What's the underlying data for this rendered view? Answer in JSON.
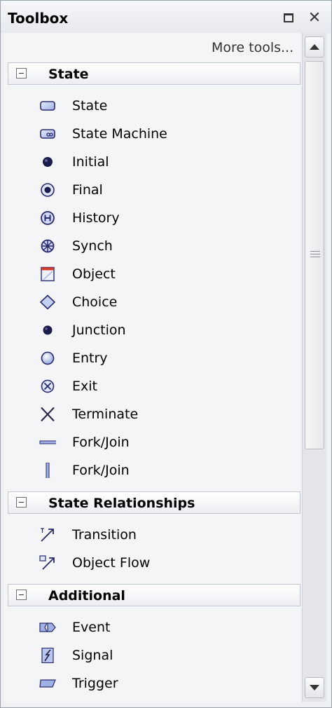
{
  "window": {
    "title": "Toolbox",
    "maximize_icon": "restore-window-icon",
    "close_glyph": "✕"
  },
  "more_tools": "More tools...",
  "groups": [
    {
      "title": "State",
      "items": [
        {
          "label": "State",
          "icon": "state-icon"
        },
        {
          "label": "State Machine",
          "icon": "state-machine-icon"
        },
        {
          "label": "Initial",
          "icon": "initial-icon"
        },
        {
          "label": "Final",
          "icon": "final-icon"
        },
        {
          "label": "History",
          "icon": "history-icon"
        },
        {
          "label": "Synch",
          "icon": "synch-icon"
        },
        {
          "label": "Object",
          "icon": "object-icon"
        },
        {
          "label": "Choice",
          "icon": "choice-icon"
        },
        {
          "label": "Junction",
          "icon": "junction-icon"
        },
        {
          "label": "Entry",
          "icon": "entry-icon"
        },
        {
          "label": "Exit",
          "icon": "exit-icon"
        },
        {
          "label": "Terminate",
          "icon": "terminate-icon"
        },
        {
          "label": "Fork/Join",
          "icon": "fork-join-horizontal-icon"
        },
        {
          "label": "Fork/Join",
          "icon": "fork-join-vertical-icon"
        }
      ]
    },
    {
      "title": "State Relationships",
      "items": [
        {
          "label": "Transition",
          "icon": "transition-icon"
        },
        {
          "label": "Object Flow",
          "icon": "object-flow-icon"
        }
      ]
    },
    {
      "title": "Additional",
      "items": [
        {
          "label": "Event",
          "icon": "event-icon"
        },
        {
          "label": "Signal",
          "icon": "signal-icon"
        },
        {
          "label": "Trigger",
          "icon": "trigger-icon"
        }
      ]
    }
  ],
  "colors": {
    "icon_fill": "#b9c6ee",
    "icon_dark": "#1c1c4a",
    "icon_stroke": "#2a2a6a",
    "accent_red": "#d23a2a"
  }
}
